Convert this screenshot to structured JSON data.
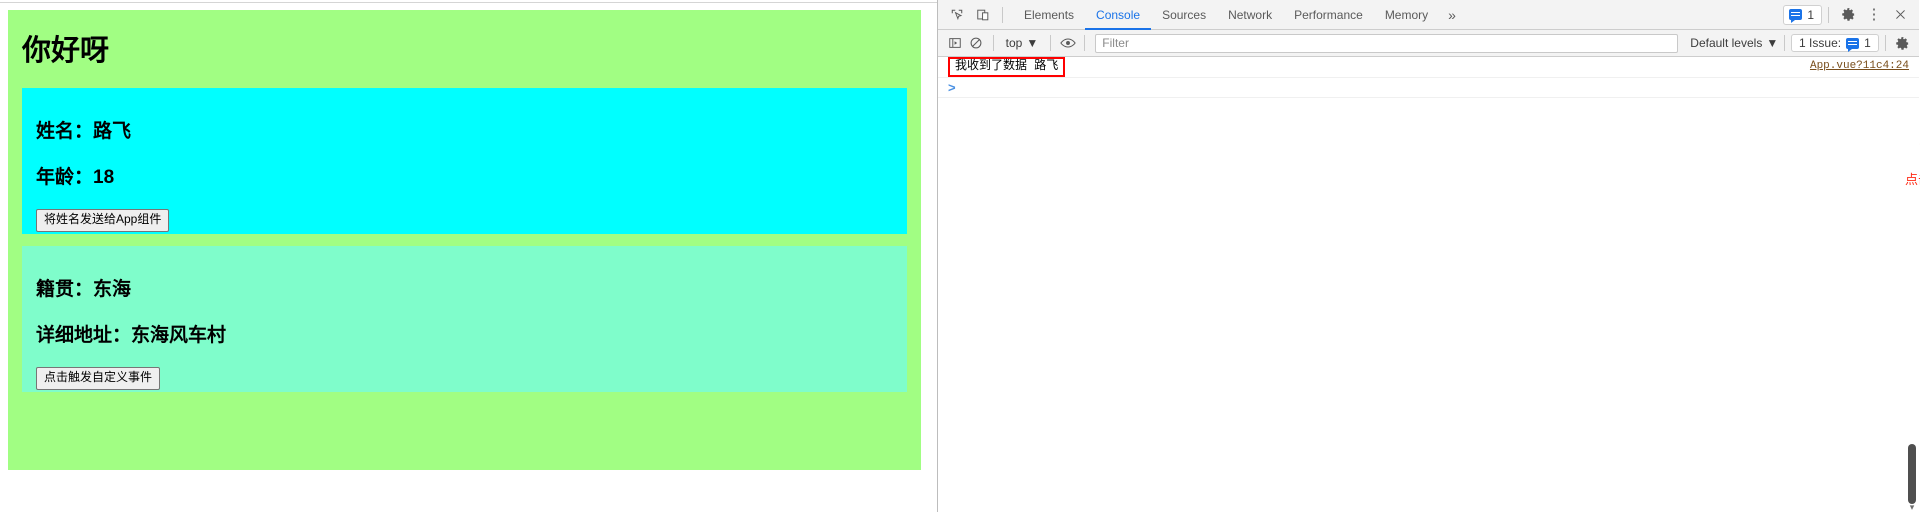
{
  "page": {
    "app_title": "你好呀",
    "student_card": {
      "name_line": "姓名：路飞",
      "age_line": "年龄：18",
      "button_label": "将姓名发送给App组件"
    },
    "school_card": {
      "origin_line": "籍贯：东海",
      "address_line": "详细地址：东海风车村",
      "button_label": "点击触发自定义事件"
    },
    "colors": {
      "app_bg": "#a1fe83",
      "student_bg": "#00ffff",
      "school_bg": "#7ffdcb"
    }
  },
  "devtools": {
    "toolbar": {
      "inspect_icon": "inspect-element-icon",
      "device_icon": "device-toolbar-icon",
      "tabs": [
        {
          "label": "Elements",
          "active": false
        },
        {
          "label": "Console",
          "active": true
        },
        {
          "label": "Sources",
          "active": false
        },
        {
          "label": "Network",
          "active": false
        },
        {
          "label": "Performance",
          "active": false
        },
        {
          "label": "Memory",
          "active": false
        }
      ],
      "more_tabs": "»",
      "message_badge_count": "1",
      "settings_icon": "gear-icon",
      "menu_icon": "kebab-menu-icon",
      "close_icon": "close-icon"
    },
    "filterbar": {
      "sidebar_toggle_icon": "console-sidebar-icon",
      "clear_icon": "clear-console-icon",
      "context_value": "top",
      "eye_icon": "live-expression-icon",
      "filter_placeholder": "Filter",
      "filter_value": "",
      "levels_value": "Default levels",
      "issues_label": "1 Issue:",
      "issues_count": "1",
      "console_settings_icon": "gear-icon"
    },
    "console": {
      "log_message": "我收到了数据 路飞",
      "log_source": "App.vue?11c4:24",
      "prompt_caret": ">"
    },
    "annotation": {
      "note_text": "点击按钮后，父组件已经收到数据",
      "color": "#ff2b16"
    }
  }
}
